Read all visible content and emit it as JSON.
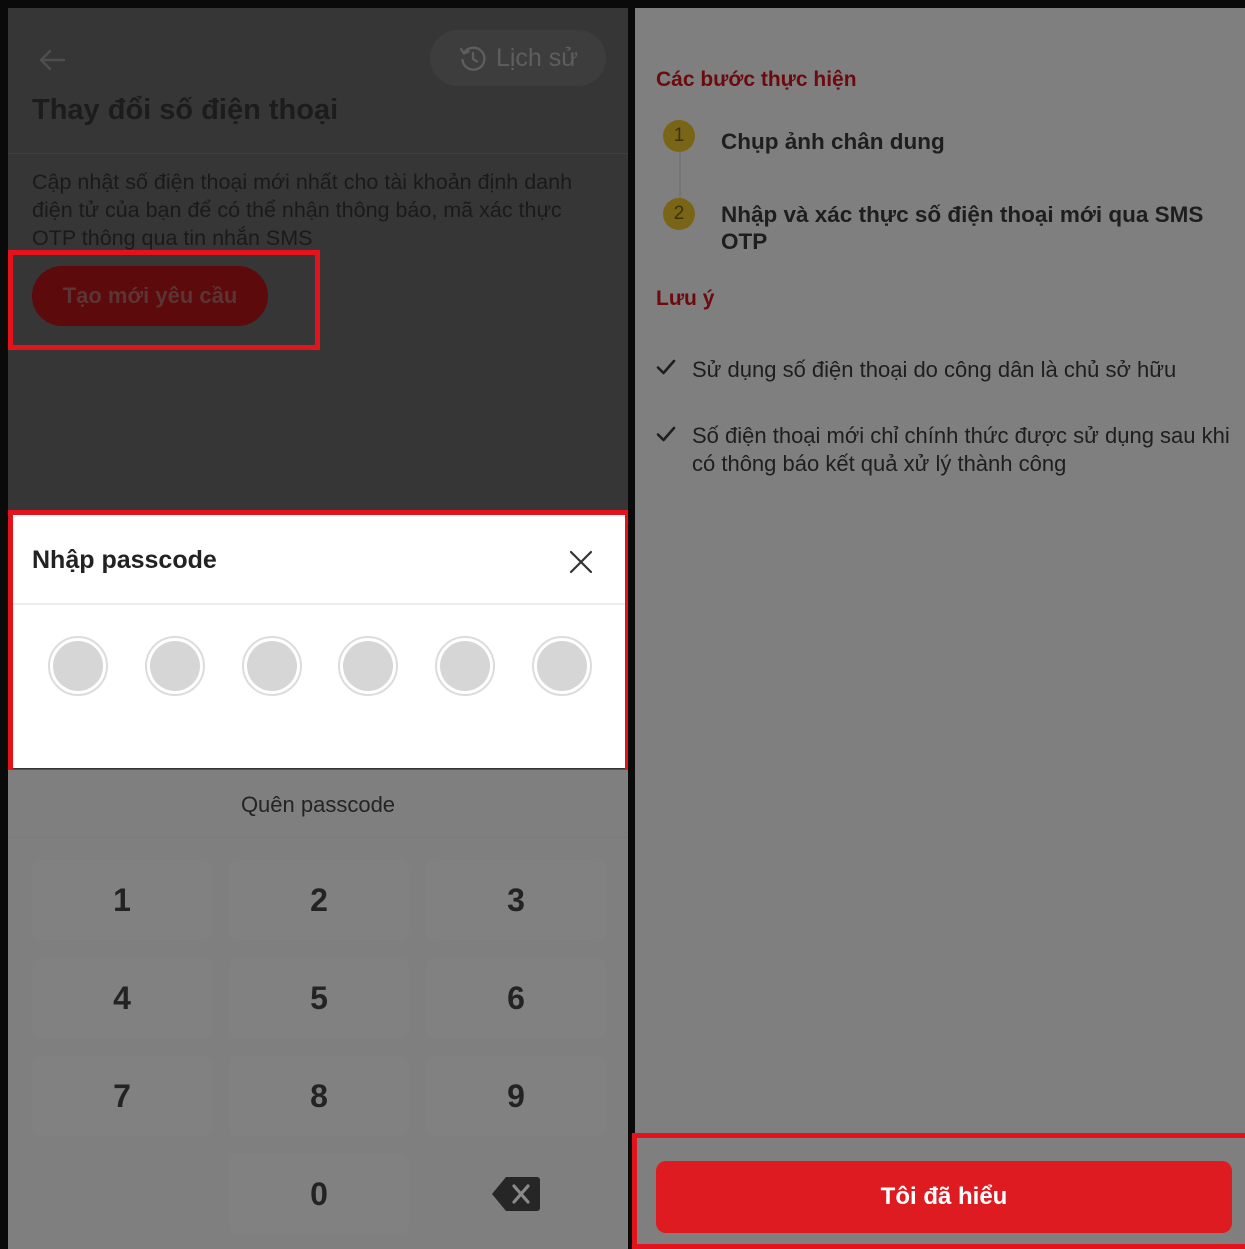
{
  "left_screen": {
    "history_label": "Lịch sử",
    "title": "Thay đổi số điện thoại",
    "description": "Cập nhật số điện thoại mới nhất cho tài khoản định danh điện tử của bạn để có thể nhận thông báo, mã xác thực OTP thông qua tin nhắn SMS",
    "create_request_label": "Tạo mới yêu cầu"
  },
  "passcode_sheet": {
    "title": "Nhập passcode",
    "digits_filled": 0,
    "digits_total": 6,
    "forgot_label": "Quên passcode"
  },
  "keypad": {
    "keys": [
      "1",
      "2",
      "3",
      "4",
      "5",
      "6",
      "7",
      "8",
      "9",
      "0"
    ]
  },
  "right_screen": {
    "steps_title": "Các bước thực hiện",
    "steps": [
      {
        "number": "1",
        "label": "Chụp ảnh chân dung"
      },
      {
        "number": "2",
        "label": "Nhập và xác thực số điện thoại mới qua SMS OTP"
      }
    ],
    "notes_title": "Lưu ý",
    "notes": [
      "Sử dụng số điện thoại do công dân là chủ sở hữu",
      "Số điện thoại mới chỉ chính thức được sử dụng sau khi có thông báo kết quả xử lý thành công"
    ],
    "confirm_label": "Tôi đã hiểu"
  },
  "colors": {
    "highlight": "#e4121a",
    "primary_red": "#de1b20",
    "step_badge": "#e9c02e"
  },
  "icons": [
    "back-arrow-icon",
    "history-icon",
    "close-icon",
    "backspace-icon",
    "check-icon"
  ]
}
